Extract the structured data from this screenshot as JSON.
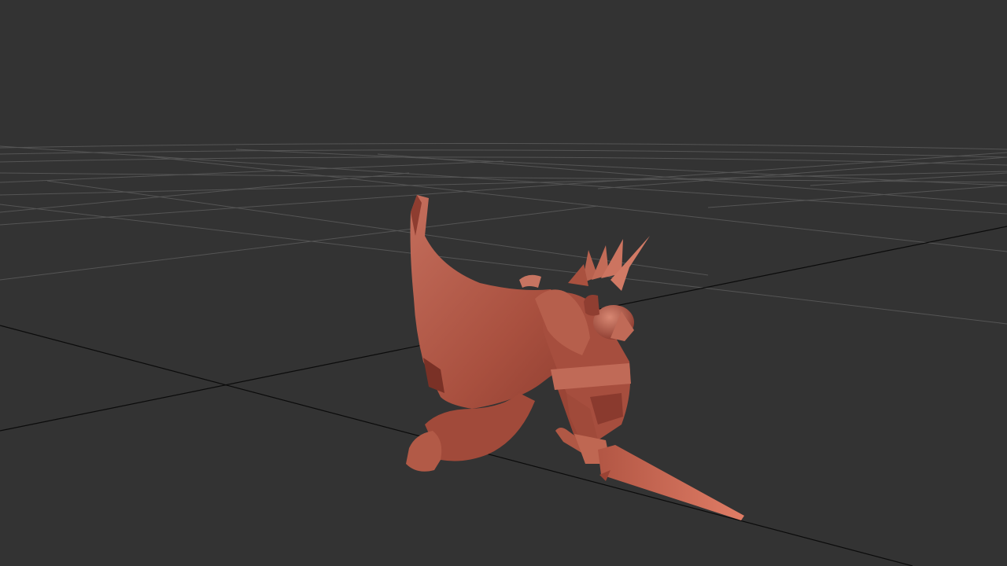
{
  "viewport": {
    "view": "perspective",
    "background_color": "#333333",
    "grid": {
      "visible": true,
      "line_color": "#555555",
      "axis_color": "#0b0b0b"
    },
    "model": {
      "subject": "armored-knight-with-cape-and-sword",
      "pose": "kneeling",
      "material_color": "#a84c3d",
      "highlight_color": "#d08a78",
      "shadow_color": "#6e2a22"
    }
  }
}
